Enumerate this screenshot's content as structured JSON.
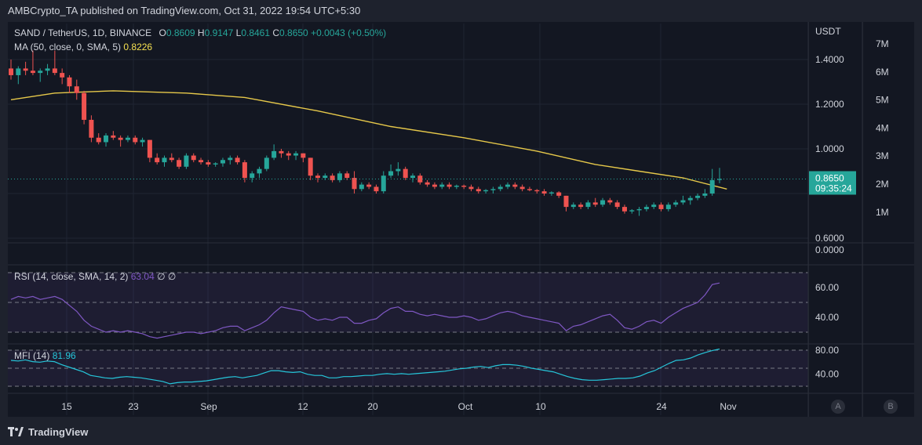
{
  "header": {
    "publisher_text": "AMBCrypto_TA published on TradingView.com, Oct 31, 2022 19:54 UTC+5:30"
  },
  "legend": {
    "symbol": "SAND / TetherUS, 1D, BINANCE",
    "o_label": "O",
    "o_value": "0.8609",
    "h_label": "H",
    "h_value": "0.9147",
    "l_label": "L",
    "l_value": "0.8461",
    "c_label": "C",
    "c_value": "0.8650",
    "change": "+0.0043 (+0.50%)",
    "ma_label": "MA (50, close, 0, SMA, 5)",
    "ma_value": "0.8226",
    "rsi_label": "RSI (14, close, SMA, 14, 2)",
    "rsi_value": "63.04",
    "rsi_extra1": "∅",
    "rsi_extra2": "∅",
    "mfi_label": "MFI (14)",
    "mfi_value": "81.96"
  },
  "price_axis": {
    "currency": "USDT",
    "ticks": [
      "1.4000",
      "1.2000",
      "1.0000",
      "0.6000",
      "0.0000"
    ],
    "last_price": "0.8650",
    "countdown": "09:35:24",
    "rsi_ticks": [
      "60.00",
      "40.00"
    ],
    "mfi_ticks": [
      "80.00",
      "40.00"
    ]
  },
  "volume_axis": {
    "ticks": [
      "7M",
      "6M",
      "5M",
      "4M",
      "3M",
      "2M",
      "1M"
    ]
  },
  "time_axis": {
    "labels": [
      "15",
      "23",
      "Sep",
      "12",
      "20",
      "Oct",
      "10",
      "24",
      "Nov"
    ]
  },
  "scale_buttons": {
    "auto": "A",
    "log": "B"
  },
  "footer": {
    "brand": "TradingView"
  },
  "colors": {
    "up": "#26a69a",
    "down": "#ef5350",
    "ma": "#e6c84a",
    "rsi": "#7e57c2",
    "mfi": "#26c6da",
    "pane_bg": "#131722"
  },
  "chart_data": {
    "type": "candlestick",
    "symbol": "SAND / TetherUS",
    "interval": "1D",
    "ohlc": [
      [
        1.36,
        1.4,
        1.31,
        1.33
      ],
      [
        1.33,
        1.37,
        1.29,
        1.36
      ],
      [
        1.36,
        1.39,
        1.33,
        1.35
      ],
      [
        1.35,
        1.44,
        1.33,
        1.34
      ],
      [
        1.34,
        1.36,
        1.3,
        1.35
      ],
      [
        1.35,
        1.38,
        1.33,
        1.36
      ],
      [
        1.36,
        1.44,
        1.33,
        1.34
      ],
      [
        1.34,
        1.36,
        1.29,
        1.32
      ],
      [
        1.32,
        1.33,
        1.25,
        1.28
      ],
      [
        1.28,
        1.31,
        1.22,
        1.25
      ],
      [
        1.25,
        1.26,
        1.11,
        1.13
      ],
      [
        1.13,
        1.15,
        1.03,
        1.05
      ],
      [
        1.05,
        1.07,
        1.02,
        1.03
      ],
      [
        1.03,
        1.07,
        1.01,
        1.06
      ],
      [
        1.06,
        1.08,
        1.04,
        1.05
      ],
      [
        1.05,
        1.06,
        1.01,
        1.04
      ],
      [
        1.04,
        1.06,
        1.03,
        1.05
      ],
      [
        1.05,
        1.06,
        1.02,
        1.03
      ],
      [
        1.03,
        1.05,
        1.01,
        1.04
      ],
      [
        1.04,
        1.04,
        0.94,
        0.96
      ],
      [
        0.96,
        0.98,
        0.93,
        0.94
      ],
      [
        0.94,
        0.97,
        0.92,
        0.96
      ],
      [
        0.96,
        0.98,
        0.94,
        0.95
      ],
      [
        0.95,
        0.96,
        0.91,
        0.92
      ],
      [
        0.92,
        0.98,
        0.91,
        0.97
      ],
      [
        0.97,
        0.98,
        0.94,
        0.95
      ],
      [
        0.95,
        0.96,
        0.93,
        0.94
      ],
      [
        0.94,
        0.95,
        0.92,
        0.93
      ],
      [
        0.93,
        0.94,
        0.92,
        0.935
      ],
      [
        0.935,
        0.96,
        0.92,
        0.95
      ],
      [
        0.95,
        0.97,
        0.93,
        0.96
      ],
      [
        0.96,
        0.97,
        0.93,
        0.94
      ],
      [
        0.94,
        0.95,
        0.85,
        0.87
      ],
      [
        0.87,
        0.9,
        0.85,
        0.89
      ],
      [
        0.89,
        0.92,
        0.87,
        0.91
      ],
      [
        0.91,
        0.97,
        0.9,
        0.96
      ],
      [
        0.96,
        1.02,
        0.95,
        0.99
      ],
      [
        0.99,
        1.0,
        0.96,
        0.98
      ],
      [
        0.98,
        0.99,
        0.95,
        0.97
      ],
      [
        0.97,
        0.99,
        0.95,
        0.98
      ],
      [
        0.98,
        0.98,
        0.94,
        0.96
      ],
      [
        0.96,
        0.96,
        0.86,
        0.88
      ],
      [
        0.88,
        0.89,
        0.85,
        0.87
      ],
      [
        0.87,
        0.89,
        0.86,
        0.88
      ],
      [
        0.88,
        0.89,
        0.85,
        0.86
      ],
      [
        0.86,
        0.9,
        0.85,
        0.89
      ],
      [
        0.89,
        0.9,
        0.86,
        0.87
      ],
      [
        0.87,
        0.9,
        0.8,
        0.82
      ],
      [
        0.82,
        0.85,
        0.81,
        0.84
      ],
      [
        0.84,
        0.85,
        0.82,
        0.83
      ],
      [
        0.83,
        0.84,
        0.8,
        0.81
      ],
      [
        0.81,
        0.9,
        0.8,
        0.88
      ],
      [
        0.88,
        0.93,
        0.87,
        0.9
      ],
      [
        0.9,
        0.94,
        0.88,
        0.91
      ],
      [
        0.91,
        0.92,
        0.86,
        0.87
      ],
      [
        0.87,
        0.89,
        0.85,
        0.88
      ],
      [
        0.88,
        0.89,
        0.84,
        0.85
      ],
      [
        0.85,
        0.86,
        0.83,
        0.84
      ],
      [
        0.84,
        0.85,
        0.82,
        0.83
      ],
      [
        0.83,
        0.85,
        0.82,
        0.84
      ],
      [
        0.84,
        0.85,
        0.82,
        0.83
      ],
      [
        0.83,
        0.84,
        0.82,
        0.835
      ],
      [
        0.835,
        0.84,
        0.82,
        0.83
      ],
      [
        0.83,
        0.84,
        0.81,
        0.82
      ],
      [
        0.82,
        0.83,
        0.8,
        0.81
      ],
      [
        0.81,
        0.82,
        0.8,
        0.815
      ],
      [
        0.815,
        0.83,
        0.8,
        0.82
      ],
      [
        0.82,
        0.84,
        0.81,
        0.83
      ],
      [
        0.83,
        0.85,
        0.82,
        0.84
      ],
      [
        0.84,
        0.85,
        0.82,
        0.83
      ],
      [
        0.83,
        0.84,
        0.81,
        0.82
      ],
      [
        0.82,
        0.83,
        0.81,
        0.815
      ],
      [
        0.815,
        0.82,
        0.8,
        0.81
      ],
      [
        0.81,
        0.82,
        0.79,
        0.8
      ],
      [
        0.8,
        0.81,
        0.79,
        0.805
      ],
      [
        0.805,
        0.81,
        0.78,
        0.79
      ],
      [
        0.79,
        0.79,
        0.72,
        0.74
      ],
      [
        0.74,
        0.76,
        0.73,
        0.75
      ],
      [
        0.75,
        0.76,
        0.73,
        0.74
      ],
      [
        0.74,
        0.77,
        0.73,
        0.76
      ],
      [
        0.76,
        0.78,
        0.74,
        0.75
      ],
      [
        0.75,
        0.78,
        0.74,
        0.77
      ],
      [
        0.77,
        0.78,
        0.75,
        0.76
      ],
      [
        0.76,
        0.77,
        0.73,
        0.74
      ],
      [
        0.74,
        0.75,
        0.71,
        0.72
      ],
      [
        0.72,
        0.73,
        0.71,
        0.725
      ],
      [
        0.725,
        0.74,
        0.7,
        0.73
      ],
      [
        0.73,
        0.75,
        0.72,
        0.74
      ],
      [
        0.74,
        0.76,
        0.73,
        0.75
      ],
      [
        0.75,
        0.76,
        0.72,
        0.73
      ],
      [
        0.73,
        0.76,
        0.72,
        0.75
      ],
      [
        0.75,
        0.77,
        0.74,
        0.76
      ],
      [
        0.76,
        0.79,
        0.75,
        0.77
      ],
      [
        0.77,
        0.79,
        0.75,
        0.78
      ],
      [
        0.78,
        0.8,
        0.77,
        0.79
      ],
      [
        0.79,
        0.82,
        0.78,
        0.8
      ],
      [
        0.8,
        0.91,
        0.79,
        0.86
      ],
      [
        0.8609,
        0.9147,
        0.8461,
        0.865
      ]
    ],
    "ma50": [
      [
        0,
        1.22
      ],
      [
        6,
        1.25
      ],
      [
        14,
        1.26
      ],
      [
        24,
        1.25
      ],
      [
        32,
        1.23
      ],
      [
        42,
        1.17
      ],
      [
        52,
        1.1
      ],
      [
        62,
        1.05
      ],
      [
        72,
        0.99
      ],
      [
        80,
        0.93
      ],
      [
        86,
        0.9
      ],
      [
        92,
        0.87
      ],
      [
        98,
        0.82
      ]
    ],
    "rsi": [
      52,
      54,
      53,
      54,
      52,
      53,
      54,
      52,
      48,
      44,
      38,
      34,
      32,
      30,
      31,
      30,
      31,
      30,
      29,
      27,
      26,
      27,
      28,
      29,
      30,
      30,
      29,
      30,
      31,
      33,
      34,
      34,
      31,
      33,
      35,
      38,
      43,
      47,
      46,
      45,
      44,
      40,
      38,
      39,
      38,
      40,
      40,
      36,
      36,
      38,
      39,
      43,
      46,
      47,
      44,
      44,
      42,
      41,
      42,
      41,
      40,
      40,
      41,
      40,
      38,
      39,
      41,
      43,
      44,
      43,
      41,
      40,
      39,
      38,
      37,
      36,
      31,
      34,
      35,
      37,
      39,
      41,
      42,
      38,
      33,
      32,
      34,
      37,
      38,
      36,
      40,
      43,
      46,
      48,
      50,
      55,
      62,
      63.04
    ],
    "mfi": [
      63,
      62,
      64,
      61,
      60,
      62,
      61,
      56,
      52,
      48,
      44,
      38,
      36,
      34,
      33,
      35,
      36,
      35,
      34,
      32,
      30,
      28,
      24,
      26,
      27,
      27,
      28,
      29,
      31,
      33,
      35,
      36,
      34,
      36,
      38,
      42,
      46,
      46,
      44,
      43,
      44,
      40,
      38,
      38,
      34,
      34,
      36,
      36,
      37,
      38,
      38,
      40,
      41,
      40,
      41,
      40,
      41,
      42,
      43,
      44,
      45,
      47,
      49,
      50,
      52,
      53,
      51,
      54,
      56,
      56,
      55,
      53,
      50,
      48,
      46,
      44,
      40,
      36,
      33,
      31,
      30,
      30,
      31,
      32,
      33,
      33,
      34,
      37,
      42,
      46,
      52,
      58,
      63,
      64,
      67,
      72,
      76,
      79.5,
      81.96
    ],
    "volume_ylim": [
      0,
      7000000
    ],
    "price_ylim": [
      0.6,
      1.44
    ],
    "rsi_ylim": [
      25,
      72
    ],
    "mfi_ylim": [
      20,
      85
    ],
    "rsi_bands": [
      30,
      50,
      70
    ],
    "mfi_bands": [
      20,
      50,
      80
    ]
  }
}
